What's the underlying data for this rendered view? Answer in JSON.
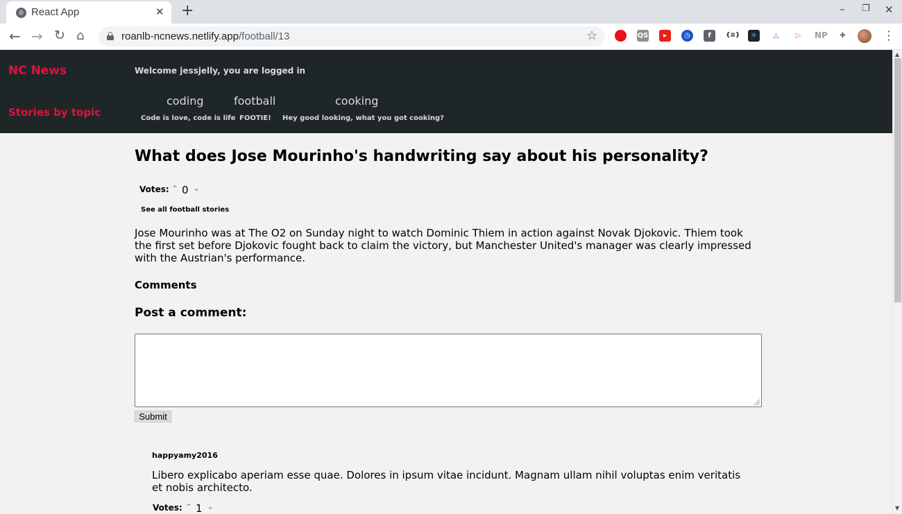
{
  "browser": {
    "tab_title": "React App",
    "url_host": "roanlb-ncnews.netlify.app",
    "url_path": "/football/13",
    "extensions": [
      {
        "icon": "adblock-icon",
        "label": "",
        "color": "#e8101a"
      },
      {
        "icon": "qs-icon",
        "label": "QS",
        "color": "#8e8e8e"
      },
      {
        "icon": "youtube-icon",
        "label": "▸",
        "color": "#e62117"
      },
      {
        "icon": "clock-icon",
        "label": "◷",
        "color": "#1a55c4"
      },
      {
        "icon": "facebook-icon",
        "label": "f",
        "color": "#5f6368"
      },
      {
        "icon": "json-icon",
        "label": "{≡}",
        "color": "#ffffff"
      },
      {
        "icon": "react-icon",
        "label": "⚛",
        "color": "#20232a"
      },
      {
        "icon": "triangle-icon",
        "label": "△",
        "color": "#ffffff"
      },
      {
        "icon": "play-icon",
        "label": "▷",
        "color": "#ffffff"
      },
      {
        "icon": "np-icon",
        "label": "NP",
        "color": "#ffffff"
      },
      {
        "icon": "puzzle-icon",
        "label": "✚",
        "color": "#ffffff"
      }
    ]
  },
  "header": {
    "brand": "NC News",
    "stories_by_topic": "Stories by topic",
    "welcome": "Welcome jessjelly, you are logged in",
    "topics": [
      {
        "name": "coding",
        "description": "Code is love, code is life"
      },
      {
        "name": "football",
        "description": "FOOTIE!"
      },
      {
        "name": "cooking",
        "description": "Hey good looking, what you got cooking?"
      }
    ]
  },
  "article": {
    "title": "What does Jose Mourinho's handwriting say about his personality?",
    "votes_label": "Votes:",
    "votes": "0",
    "see_all": "See all football stories",
    "body": "Jose Mourinho was at The O2 on Sunday night to watch Dominic Thiem in action against Novak Djokovic. Thiem took the first set before Djokovic fought back to claim the victory, but Manchester United's manager was clearly impressed with the Austrian's performance."
  },
  "comments": {
    "heading": "Comments",
    "post_heading": "Post a comment:",
    "input_value": "",
    "submit_label": "Submit",
    "items": [
      {
        "author": "happyamy2016",
        "body": "Libero explicabo aperiam esse quae. Dolores in ipsum vitae incidunt. Magnam ullam nihil voluptas enim veritatis et nobis architecto.",
        "votes_label": "Votes:",
        "votes": "1"
      }
    ]
  }
}
